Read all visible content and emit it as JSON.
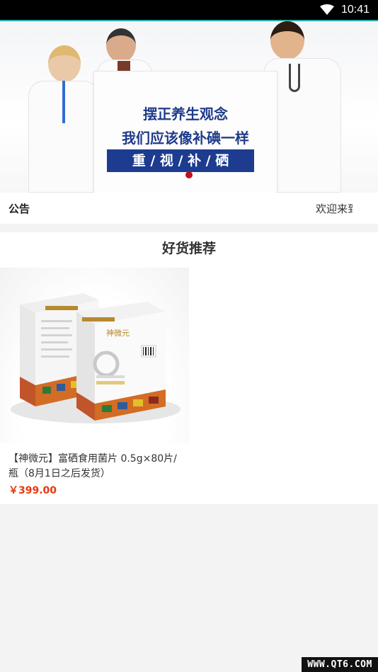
{
  "status_bar": {
    "time": "10:41",
    "icons": [
      "wifi-icon"
    ],
    "background": "#000000"
  },
  "banner": {
    "sign_line1": "摆正养生观念",
    "sign_line2": "我们应该像补碘一样",
    "sign_highlight": "重 / 视 / 补 / 硒",
    "carousel_indicator_color": "#c0111b",
    "sign_text_color": "#1f3b8a"
  },
  "notice": {
    "label": "公告",
    "marquee_text": "欢迎来到"
  },
  "goods_section": {
    "title": "好货推荐",
    "products": [
      {
        "name": "【神微元】富硒食用菌片 0.5g×80片/瓶（8月1日之后发货）",
        "price": "￥399.00",
        "image": "product-box-image"
      }
    ],
    "price_color": "#e8380d"
  },
  "watermark": {
    "text": "WWW.QT6.COM"
  }
}
